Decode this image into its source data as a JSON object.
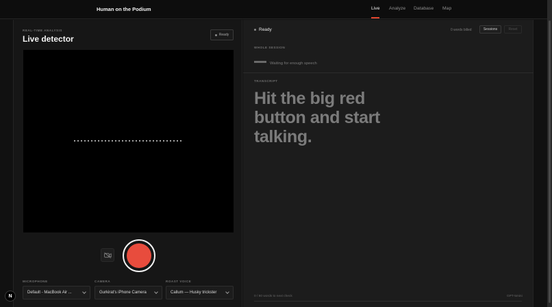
{
  "header": {
    "brand": "Human on the Podium",
    "nav": [
      {
        "label": "Live",
        "active": true
      },
      {
        "label": "Analyze",
        "active": false
      },
      {
        "label": "Database",
        "active": false
      },
      {
        "label": "Map",
        "active": false
      }
    ],
    "accent_color": "#e2462f"
  },
  "detector": {
    "eyebrow": "REAL-TIME ANALYSIS",
    "title": "Live detector",
    "status_button": "Ready",
    "record_button_color": "#e84c3d",
    "camera_toggle_icon": "camera-off-icon"
  },
  "controls": {
    "microphone": {
      "label": "MICROPHONE",
      "value": "Default - MacBook Air ..."
    },
    "camera": {
      "label": "CAMERA",
      "value": "Gurkirat's iPhone Camera"
    },
    "roast_voice": {
      "label": "ROAST VOICE",
      "value": "Callum — Husky trickster"
    }
  },
  "session": {
    "status": "Ready",
    "words_banked": "0 words billed",
    "sessions_button": "Sessions",
    "reset_button": "Reset",
    "whole_session_label": "WHOLE SESSION",
    "waiting_text": "Waiting for enough speech",
    "transcript_label": "TRANSCRIPT",
    "headline": "Hit the big red button and start talking.",
    "progress_text": "0 / 80 words to next check",
    "model_label": "GPT-5mini"
  },
  "badge": "N"
}
